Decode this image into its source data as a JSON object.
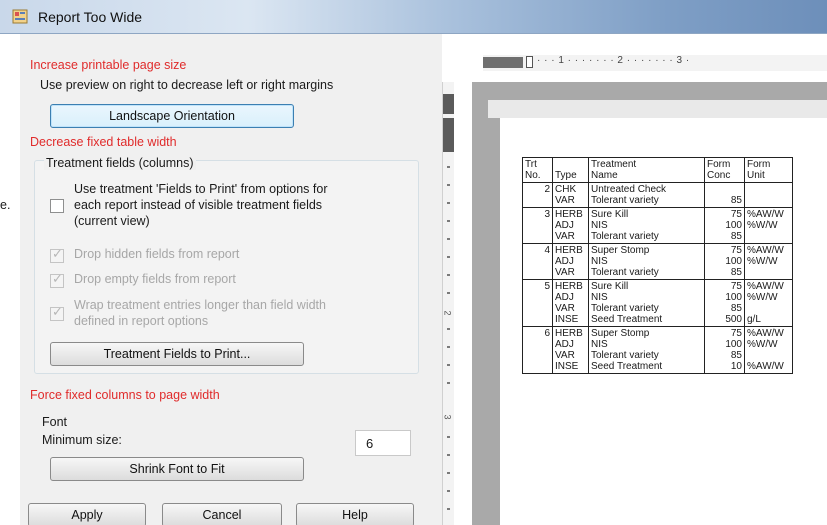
{
  "window": {
    "title": "Report Too Wide",
    "ghost_title": ""
  },
  "left_edge_text": "e.",
  "sections": {
    "increase": {
      "heading": "Increase printable page size",
      "description": "Use preview on right to decrease left or right margins",
      "button": "Landscape Orientation"
    },
    "decrease": {
      "heading": "Decrease fixed table width",
      "group_title": "Treatment fields (columns)",
      "use_fields_option": {
        "lines": [
          "Use treatment 'Fields to Print' from options for",
          "each report instead of visible treatment fields",
          "(current view)"
        ],
        "checked": false
      },
      "drop_hidden": "Drop hidden fields from report",
      "drop_empty": "Drop empty fields from report",
      "wrap_lines": [
        "Wrap treatment entries longer than field width",
        "defined in report options"
      ],
      "button": "Treatment Fields to Print..."
    },
    "force": {
      "heading": "Force fixed columns to page width",
      "font_label": "Font",
      "min_size_label": "Minimum size:",
      "min_size_value": "6",
      "button": "Shrink Font to Fit"
    }
  },
  "footer": {
    "apply": "Apply",
    "cancel": "Cancel",
    "help": "Help"
  },
  "ruler": {
    "h_text": "· · · 1 · · · · · · · 2 · · · · · · · 3 ·",
    "v_labels": [
      "1",
      "2",
      "3"
    ]
  },
  "report": {
    "headers": [
      [
        "Trt",
        "No."
      ],
      [
        "Type"
      ],
      [
        "Treatment",
        "Name"
      ],
      [
        "Form",
        "Conc"
      ],
      [
        "Form",
        "Unit"
      ]
    ],
    "rows": [
      {
        "no": "2",
        "types": [
          "CHK",
          "VAR"
        ],
        "names": [
          "Untreated Check",
          "Tolerant variety"
        ],
        "conc": [
          "",
          "85"
        ],
        "units": [
          "",
          ""
        ]
      },
      {
        "no": "3",
        "types": [
          "HERB",
          "ADJ",
          "VAR"
        ],
        "names": [
          "Sure Kill",
          "NIS",
          "Tolerant variety"
        ],
        "conc": [
          "75",
          "100",
          "85"
        ],
        "units": [
          "%AW/W",
          "%W/W",
          ""
        ]
      },
      {
        "no": "4",
        "types": [
          "HERB",
          "ADJ",
          "VAR"
        ],
        "names": [
          "Super Stomp",
          "NIS",
          "Tolerant variety"
        ],
        "conc": [
          "75",
          "100",
          "85"
        ],
        "units": [
          "%AW/W",
          "%W/W",
          ""
        ]
      },
      {
        "no": "5",
        "types": [
          "HERB",
          "ADJ",
          "VAR",
          "INSE"
        ],
        "names": [
          "Sure Kill",
          "NIS",
          "Tolerant variety",
          "Seed Treatment"
        ],
        "conc": [
          "75",
          "100",
          "85",
          "500"
        ],
        "units": [
          "%AW/W",
          "%W/W",
          "",
          "g/L"
        ]
      },
      {
        "no": "6",
        "types": [
          "HERB",
          "ADJ",
          "VAR",
          "INSE"
        ],
        "names": [
          "Super Stomp",
          "NIS",
          "Tolerant variety",
          "Seed Treatment"
        ],
        "conc": [
          "75",
          "100",
          "85",
          "10"
        ],
        "units": [
          "%AW/W",
          "%W/W",
          "",
          "%AW/W"
        ]
      }
    ]
  }
}
